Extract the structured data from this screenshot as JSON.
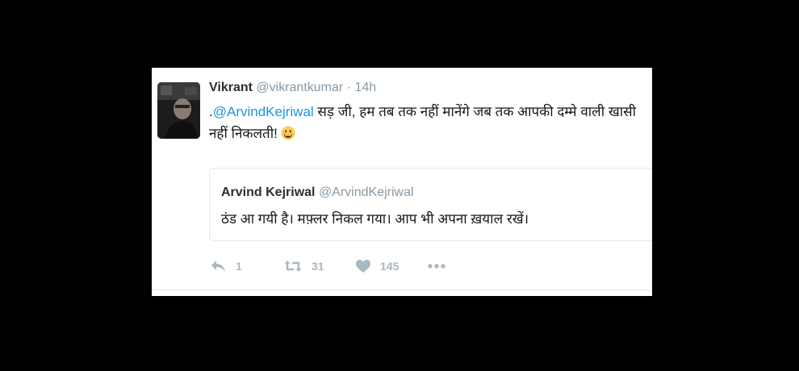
{
  "tweet": {
    "author_name": "Vikrant",
    "author_handle": "@vikrantkumar",
    "separator": " · ",
    "timestamp": "14h",
    "text_prefix": ".",
    "mention": "@ArvindKejriwal",
    "text_body": " सड़ जी, हम तब तक नहीं मानेंगे जब तक आपकी दम्मे वाली खासी नहीं निकलती!",
    "emoji_icon": "grinning-face-emoji"
  },
  "quoted_tweet": {
    "author_name": "Arvind Kejriwal",
    "author_handle": "@ArvindKejriwal",
    "text": "ठंड आ गयी है। मफ़्लर निकल गया। आप भी अपना ख़याल रखें।"
  },
  "actions": {
    "reply_count": "1",
    "retweet_count": "31",
    "like_count": "145",
    "reply_icon": "reply-icon",
    "retweet_icon": "retweet-icon",
    "like_icon": "heart-icon",
    "more_icon": "more-dots-icon"
  },
  "colors": {
    "mention": "#1b95e0",
    "meta_text": "#8899a6",
    "action_icon": "#aab8c2"
  }
}
